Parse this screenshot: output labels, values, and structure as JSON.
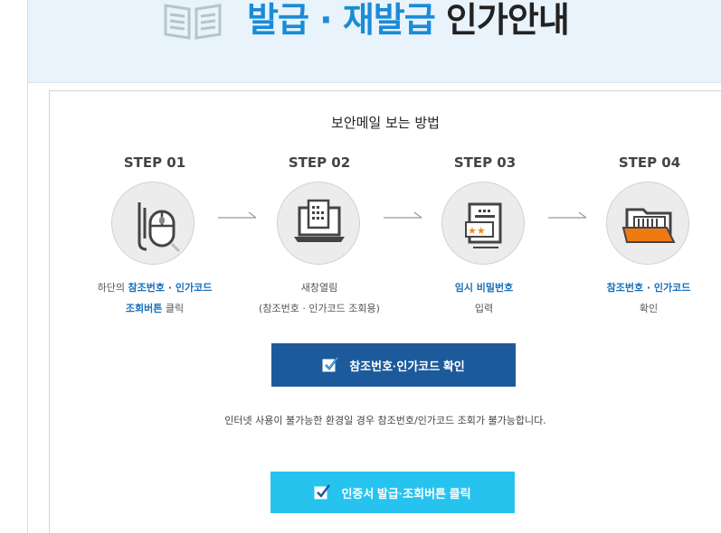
{
  "banner": {
    "icon": "open-book-icon",
    "title_part1": "발급 · 재발급",
    "title_part2": " 인가안내"
  },
  "panel": {
    "title": "보안메일 보는 방법",
    "steps": [
      {
        "label": "STEP 01",
        "icon": "mouse-click-icon",
        "line1_prefix": "하단의 ",
        "line1_highlight": "참조번호 · 인가코드",
        "line2_highlight": "조회버튼",
        "line2_suffix": " 클릭"
      },
      {
        "label": "STEP 02",
        "icon": "laptop-document-icon",
        "line1": "새창열림",
        "line2": "(참조번호 · 인가코드 조회용)"
      },
      {
        "label": "STEP 03",
        "icon": "password-document-icon",
        "line1_highlight": "임시 비밀번호",
        "line2": "입력"
      },
      {
        "label": "STEP 04",
        "icon": "open-folder-icon",
        "line1_highlight": "참조번호 · 인가코드",
        "line2": "확인"
      }
    ],
    "confirm_button": "참조번호·인가코드 확인",
    "notice": "인터넷 사용이 불가능한 환경일 경우 참조번호/인가코드 조회가 불가능합니다.",
    "cert_button": "인증서 발급·조회버튼 클릭"
  },
  "colors": {
    "accent_blue": "#1a8bd8",
    "highlight_text": "#1a6fb8",
    "dark_button": "#1c5a9c",
    "light_button": "#27c3ef",
    "folder_orange": "#f07a12"
  }
}
